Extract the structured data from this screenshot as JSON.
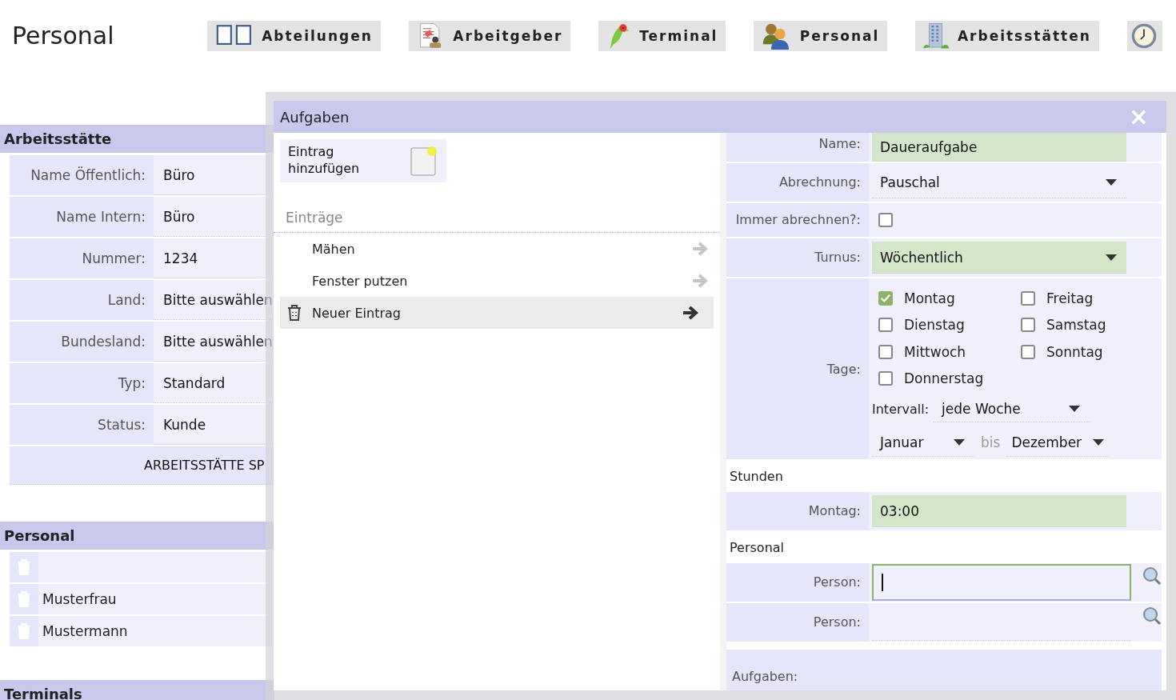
{
  "header": {
    "title": "Personal",
    "nav": [
      {
        "kind": "panels",
        "label": "Abteilungen"
      },
      {
        "kind": "document",
        "label": "Arbeitgeber"
      },
      {
        "kind": "bird",
        "label": "Terminal"
      },
      {
        "kind": "people",
        "label": "Personal"
      },
      {
        "kind": "building",
        "label": "Arbeitsstätten"
      },
      {
        "kind": "clock"
      }
    ]
  },
  "workplace_panel": {
    "title": "Arbeitsstätte",
    "fields": [
      {
        "label": "Name Öffentlich:",
        "value": "Büro"
      },
      {
        "label": "Name Intern:",
        "value": "Büro"
      },
      {
        "label": "Nummer:",
        "value": "1234"
      },
      {
        "label": "Land:",
        "value": "Bitte auswählen"
      },
      {
        "label": "Bundesland:",
        "value": "Bitte auswählen"
      },
      {
        "label": "Typ:",
        "value": "Standard"
      },
      {
        "label": "Status:",
        "value": "Kunde"
      }
    ],
    "save_button": "ARBEITSSTÄTTE SP"
  },
  "staff_panel": {
    "title": "Personal",
    "rows": [
      {},
      {
        "name": "Musterfrau"
      },
      {
        "name": "Mustermann"
      }
    ]
  },
  "terminals_panel": {
    "title": "Terminals"
  },
  "dialog": {
    "title": "Aufgaben",
    "close": "×",
    "add_button": "Eintrag hinzufügen",
    "entries_heading": "Einträge",
    "entries": [
      {
        "label": "Mähen",
        "selected": false
      },
      {
        "label": "Fenster putzen",
        "selected": false
      },
      {
        "label": "Neuer Eintrag",
        "selected": true
      }
    ],
    "form": [
      {
        "kind": "text",
        "label": "Name:",
        "value": "Daueraufgabe",
        "valid": true
      },
      {
        "kind": "select",
        "label": "Abrechnung:",
        "value": "Pauschal",
        "valid": false
      },
      {
        "kind": "checkbox",
        "label": "Immer abrechnen?:",
        "checked": false
      },
      {
        "kind": "select",
        "label": "Turnus:",
        "value": "Wöchentlich",
        "valid": true
      },
      {
        "kind": "days",
        "label": "Tage:",
        "days": [
          {
            "name": "Montag",
            "checked": true
          },
          {
            "name": "Dienstag",
            "checked": false
          },
          {
            "name": "Mittwoch",
            "checked": false
          },
          {
            "name": "Donnerstag",
            "checked": false
          },
          {
            "name": "Freitag",
            "checked": false
          },
          {
            "name": "Samstag",
            "checked": false
          },
          {
            "name": "Sonntag",
            "checked": false
          }
        ],
        "interval_label": "Intervall:",
        "interval": "jede Woche",
        "from": "Januar",
        "to_label": "bis",
        "to": "Dezember"
      },
      {
        "kind": "heading",
        "label": "Stunden"
      },
      {
        "kind": "text",
        "label": "Montag:",
        "value": "03:00",
        "valid": true
      },
      {
        "kind": "heading",
        "label": "Personal"
      },
      {
        "kind": "search",
        "label": "Person:",
        "focused": true
      },
      {
        "kind": "search",
        "label": "Person:",
        "focused": false
      },
      {
        "kind": "area",
        "label": "Aufgaben:"
      }
    ]
  }
}
